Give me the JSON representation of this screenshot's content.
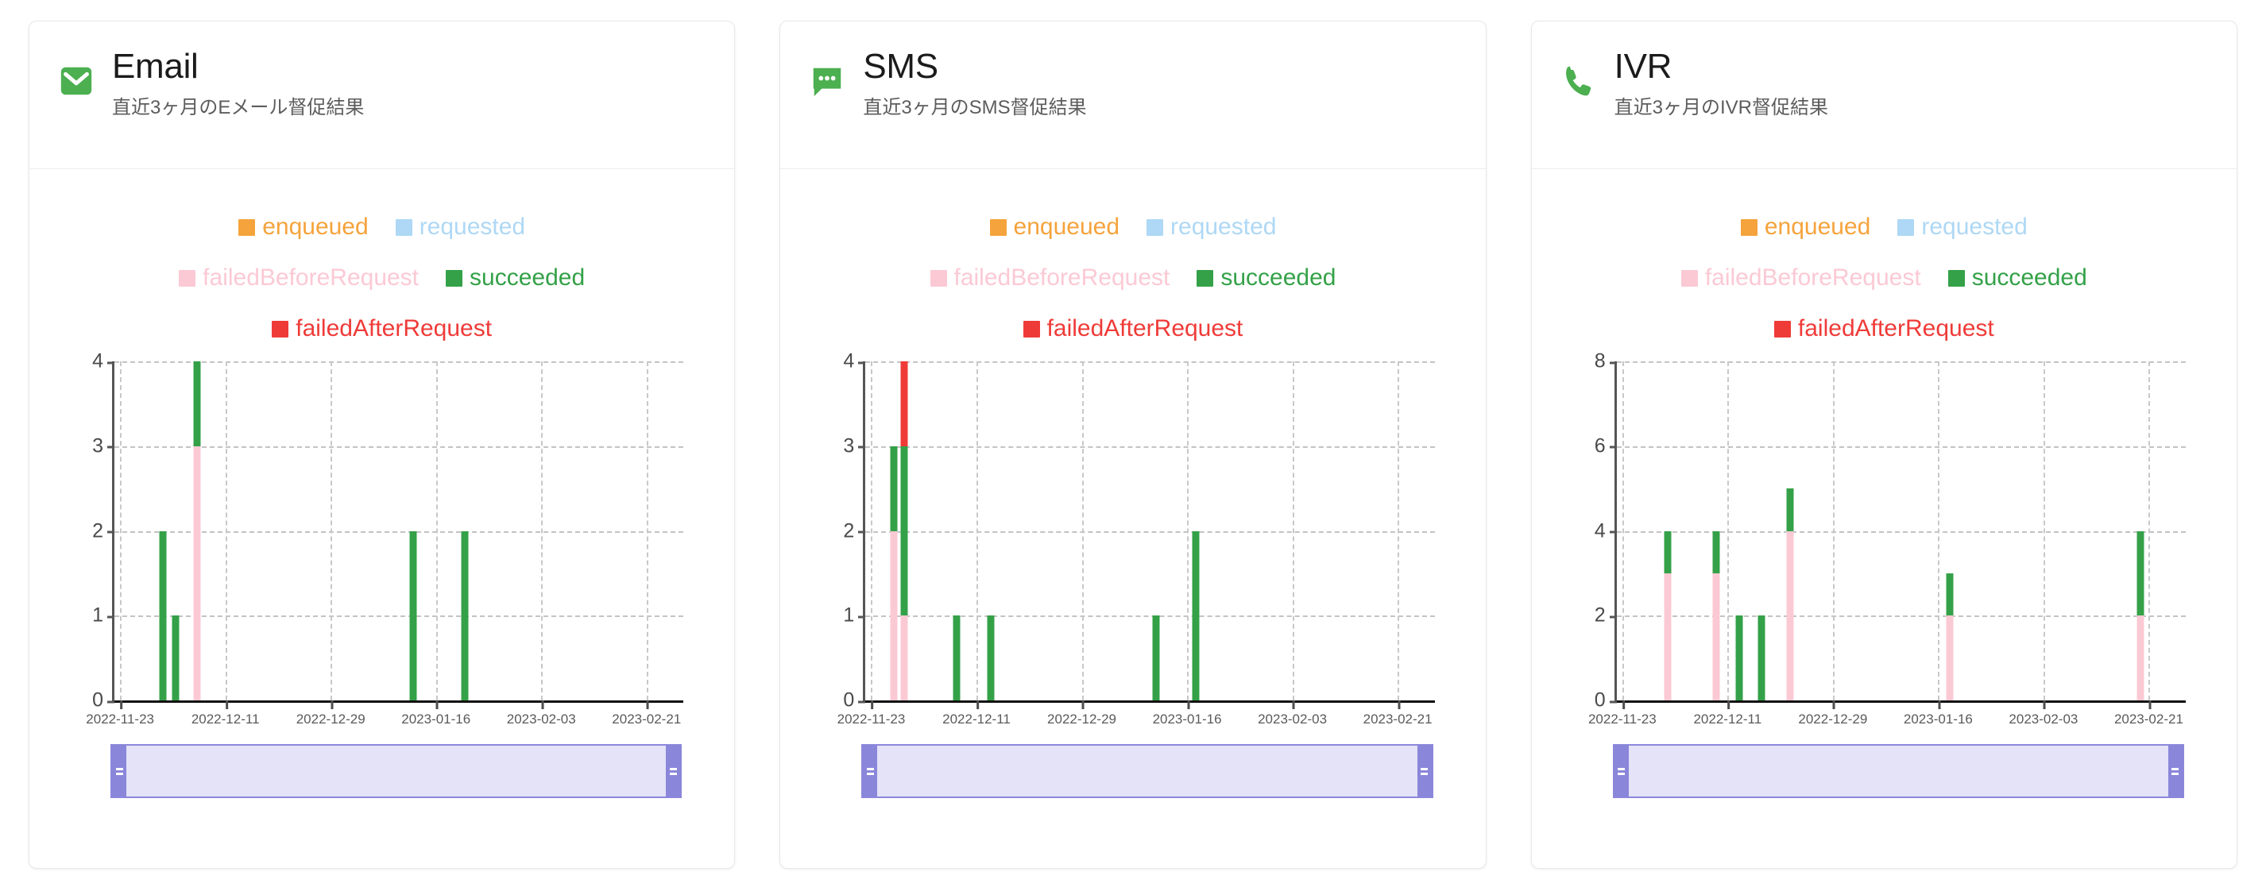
{
  "legend_colors": {
    "enqueued": "#f5a33c",
    "requested": "#aed8f5",
    "failedBeforeRequest": "#fbc9d4",
    "succeeded": "#34a148",
    "failedAfterRequest": "#ef3b38"
  },
  "legend": {
    "row1": [
      {
        "label": "enqueued",
        "color_key": "enqueued"
      },
      {
        "label": "requested",
        "color_key": "requested"
      }
    ],
    "row2": [
      {
        "label": "failedBeforeRequest",
        "color_key": "failedBeforeRequest"
      },
      {
        "label": "succeeded",
        "color_key": "succeeded"
      }
    ],
    "row3": [
      {
        "label": "failedAfterRequest",
        "color_key": "failedAfterRequest"
      }
    ]
  },
  "cards": [
    {
      "id": "email",
      "icon": "envelope-icon",
      "title": "Email",
      "subtitle": "直近3ヶ月のEメール督促結果",
      "accent": "#4caf50"
    },
    {
      "id": "sms",
      "icon": "chat-bubble-icon",
      "title": "SMS",
      "subtitle": "直近3ヶ月のSMS督促結果",
      "accent": "#4caf50"
    },
    {
      "id": "ivr",
      "icon": "phone-icon",
      "title": "IVR",
      "subtitle": "直近3ヶ月のIVR督促結果",
      "accent": "#4caf50"
    }
  ],
  "chart_data": [
    {
      "type": "bar",
      "title": "Email",
      "subtitle": "直近3ヶ月のEメール督促結果",
      "stacked": true,
      "xlabel": "",
      "ylabel": "",
      "ylim": [
        0,
        4
      ],
      "yticks": [
        0,
        1,
        2,
        3,
        4
      ],
      "xtick_labels": [
        "2022-11-23",
        "2022-12-11",
        "2022-12-29",
        "2023-01-16",
        "2023-02-03",
        "2023-02-21"
      ],
      "xtick_positions_pct": [
        1.0,
        19.5,
        38.0,
        56.5,
        75.0,
        93.5
      ],
      "grid": true,
      "legend_position": "top-center",
      "series": [
        {
          "name": "enqueued",
          "color": "#f5a33c"
        },
        {
          "name": "requested",
          "color": "#aed8f5"
        },
        {
          "name": "failedBeforeRequest",
          "color": "#fbc9d4"
        },
        {
          "name": "succeeded",
          "color": "#34a148"
        },
        {
          "name": "failedAfterRequest",
          "color": "#ef3b38"
        }
      ],
      "bars": [
        {
          "x_pct": 8.5,
          "segments": [
            {
              "series": "succeeded",
              "from": 0,
              "to": 2
            }
          ]
        },
        {
          "x_pct": 10.8,
          "segments": [
            {
              "series": "succeeded",
              "from": 0,
              "to": 1
            }
          ]
        },
        {
          "x_pct": 14.5,
          "segments": [
            {
              "series": "failedBeforeRequest",
              "from": 0,
              "to": 3
            },
            {
              "series": "succeeded",
              "from": 3,
              "to": 4
            }
          ]
        },
        {
          "x_pct": 52.5,
          "segments": [
            {
              "series": "succeeded",
              "from": 0,
              "to": 2
            }
          ]
        },
        {
          "x_pct": 61.5,
          "segments": [
            {
              "series": "succeeded",
              "from": 0,
              "to": 2
            }
          ]
        }
      ]
    },
    {
      "type": "bar",
      "title": "SMS",
      "subtitle": "直近3ヶ月のSMS督促結果",
      "stacked": true,
      "xlabel": "",
      "ylabel": "",
      "ylim": [
        0,
        4
      ],
      "yticks": [
        0,
        1,
        2,
        3,
        4
      ],
      "xtick_labels": [
        "2022-11-23",
        "2022-12-11",
        "2022-12-29",
        "2023-01-16",
        "2023-02-03",
        "2023-02-21"
      ],
      "xtick_positions_pct": [
        1.0,
        19.5,
        38.0,
        56.5,
        75.0,
        93.5
      ],
      "grid": true,
      "legend_position": "top-center",
      "series": [
        {
          "name": "enqueued",
          "color": "#f5a33c"
        },
        {
          "name": "requested",
          "color": "#aed8f5"
        },
        {
          "name": "failedBeforeRequest",
          "color": "#fbc9d4"
        },
        {
          "name": "succeeded",
          "color": "#34a148"
        },
        {
          "name": "failedAfterRequest",
          "color": "#ef3b38"
        }
      ],
      "bars": [
        {
          "x_pct": 5.0,
          "segments": [
            {
              "series": "failedBeforeRequest",
              "from": 0,
              "to": 2
            },
            {
              "series": "succeeded",
              "from": 2,
              "to": 3
            }
          ]
        },
        {
          "x_pct": 6.8,
          "segments": [
            {
              "series": "failedBeforeRequest",
              "from": 0,
              "to": 1
            },
            {
              "series": "succeeded",
              "from": 1,
              "to": 3
            },
            {
              "series": "failedAfterRequest",
              "from": 3,
              "to": 4
            }
          ]
        },
        {
          "x_pct": 16.0,
          "segments": [
            {
              "series": "succeeded",
              "from": 0,
              "to": 1
            }
          ]
        },
        {
          "x_pct": 22.0,
          "segments": [
            {
              "series": "succeeded",
              "from": 0,
              "to": 1
            }
          ]
        },
        {
          "x_pct": 51.0,
          "segments": [
            {
              "series": "succeeded",
              "from": 0,
              "to": 1
            }
          ]
        },
        {
          "x_pct": 58.0,
          "segments": [
            {
              "series": "succeeded",
              "from": 0,
              "to": 2
            }
          ]
        }
      ]
    },
    {
      "type": "bar",
      "title": "IVR",
      "subtitle": "直近3ヶ月のIVR督促結果",
      "stacked": true,
      "xlabel": "",
      "ylabel": "",
      "ylim": [
        0,
        8
      ],
      "yticks": [
        0,
        2,
        4,
        6,
        8
      ],
      "xtick_labels": [
        "2022-11-23",
        "2022-12-11",
        "2022-12-29",
        "2023-01-16",
        "2023-02-03",
        "2023-02-21"
      ],
      "xtick_positions_pct": [
        1.0,
        19.5,
        38.0,
        56.5,
        75.0,
        93.5
      ],
      "grid": true,
      "legend_position": "top-center",
      "series": [
        {
          "name": "enqueued",
          "color": "#f5a33c"
        },
        {
          "name": "requested",
          "color": "#aed8f5"
        },
        {
          "name": "failedBeforeRequest",
          "color": "#fbc9d4"
        },
        {
          "name": "succeeded",
          "color": "#34a148"
        },
        {
          "name": "failedAfterRequest",
          "color": "#ef3b38"
        }
      ],
      "bars": [
        {
          "x_pct": 9.0,
          "segments": [
            {
              "series": "failedBeforeRequest",
              "from": 0,
              "to": 3
            },
            {
              "series": "succeeded",
              "from": 3,
              "to": 4
            }
          ]
        },
        {
          "x_pct": 17.5,
          "segments": [
            {
              "series": "failedBeforeRequest",
              "from": 0,
              "to": 3
            },
            {
              "series": "succeeded",
              "from": 3,
              "to": 4
            }
          ]
        },
        {
          "x_pct": 21.5,
          "segments": [
            {
              "series": "succeeded",
              "from": 0,
              "to": 2
            }
          ]
        },
        {
          "x_pct": 25.5,
          "segments": [
            {
              "series": "succeeded",
              "from": 0,
              "to": 2
            }
          ]
        },
        {
          "x_pct": 30.5,
          "segments": [
            {
              "series": "failedBeforeRequest",
              "from": 0,
              "to": 4
            },
            {
              "series": "succeeded",
              "from": 4,
              "to": 5
            }
          ]
        },
        {
          "x_pct": 58.5,
          "segments": [
            {
              "series": "failedBeforeRequest",
              "from": 0,
              "to": 2
            },
            {
              "series": "succeeded",
              "from": 2,
              "to": 3
            }
          ]
        },
        {
          "x_pct": 92.0,
          "segments": [
            {
              "series": "failedBeforeRequest",
              "from": 0,
              "to": 2
            },
            {
              "series": "succeeded",
              "from": 2,
              "to": 4
            }
          ]
        }
      ]
    }
  ],
  "range_slider": {
    "left_handle": "range-left-handle",
    "right_handle": "range-right-handle",
    "track_color": "#e4e3f7",
    "handle_color": "#8a86da"
  }
}
